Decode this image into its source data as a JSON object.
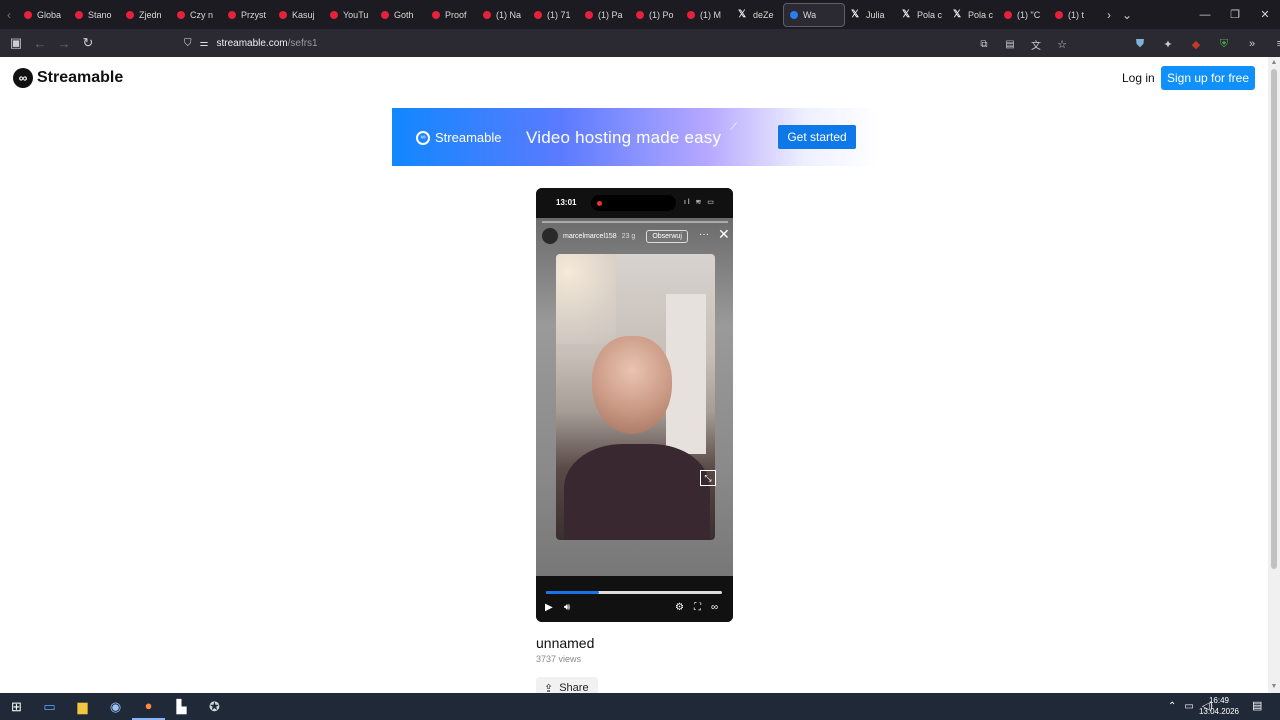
{
  "browser": {
    "tabs": [
      {
        "label": "Globa",
        "favicon": "youtube-icon"
      },
      {
        "label": "Stano",
        "favicon": "youtube-icon"
      },
      {
        "label": "Zjedn",
        "favicon": "youtube-icon"
      },
      {
        "label": "Czy n",
        "favicon": "youtube-icon"
      },
      {
        "label": "Przyst",
        "favicon": "youtube-icon"
      },
      {
        "label": "Kasuj",
        "favicon": "youtube-icon"
      },
      {
        "label": "YouTu",
        "favicon": "youtube-icon"
      },
      {
        "label": "Goth",
        "favicon": "youtube-icon"
      },
      {
        "label": "Proof",
        "favicon": "youtube-icon"
      },
      {
        "label": "(1) Na",
        "favicon": "youtube-icon"
      },
      {
        "label": "(1) 71",
        "favicon": "youtube-icon"
      },
      {
        "label": "(1) Pa",
        "favicon": "youtube-icon"
      },
      {
        "label": "(1) Po",
        "favicon": "youtube-icon"
      },
      {
        "label": "(1) M",
        "favicon": "youtube-icon"
      },
      {
        "label": "deZe",
        "favicon": "x-icon"
      },
      {
        "label": "Wa",
        "favicon": "streamable-icon",
        "active": true
      },
      {
        "label": "Julia",
        "favicon": "x-icon"
      },
      {
        "label": "Pola c",
        "favicon": "x-icon"
      },
      {
        "label": "Pola c",
        "favicon": "x-icon"
      },
      {
        "label": "(1) \"C",
        "favicon": "youtube-icon"
      },
      {
        "label": "(1) t",
        "favicon": "youtube-icon"
      }
    ],
    "url_host": "streamable.com",
    "url_path": "/sefrs1"
  },
  "site": {
    "brand": "Streamable",
    "login": "Log in",
    "signup": "Sign up for free"
  },
  "banner": {
    "brand": "Streamable",
    "tagline": "Video hosting made easy",
    "cta": "Get started"
  },
  "video": {
    "status_time": "13:01",
    "username": "marcelmarcel158",
    "age": "23 g",
    "follow": "Obserwuj",
    "progress": 0.3
  },
  "meta": {
    "title": "unnamed",
    "views": "3737 views",
    "share": "Share"
  },
  "taskbar": {
    "time": "16:49",
    "date": "13.04.2026"
  }
}
